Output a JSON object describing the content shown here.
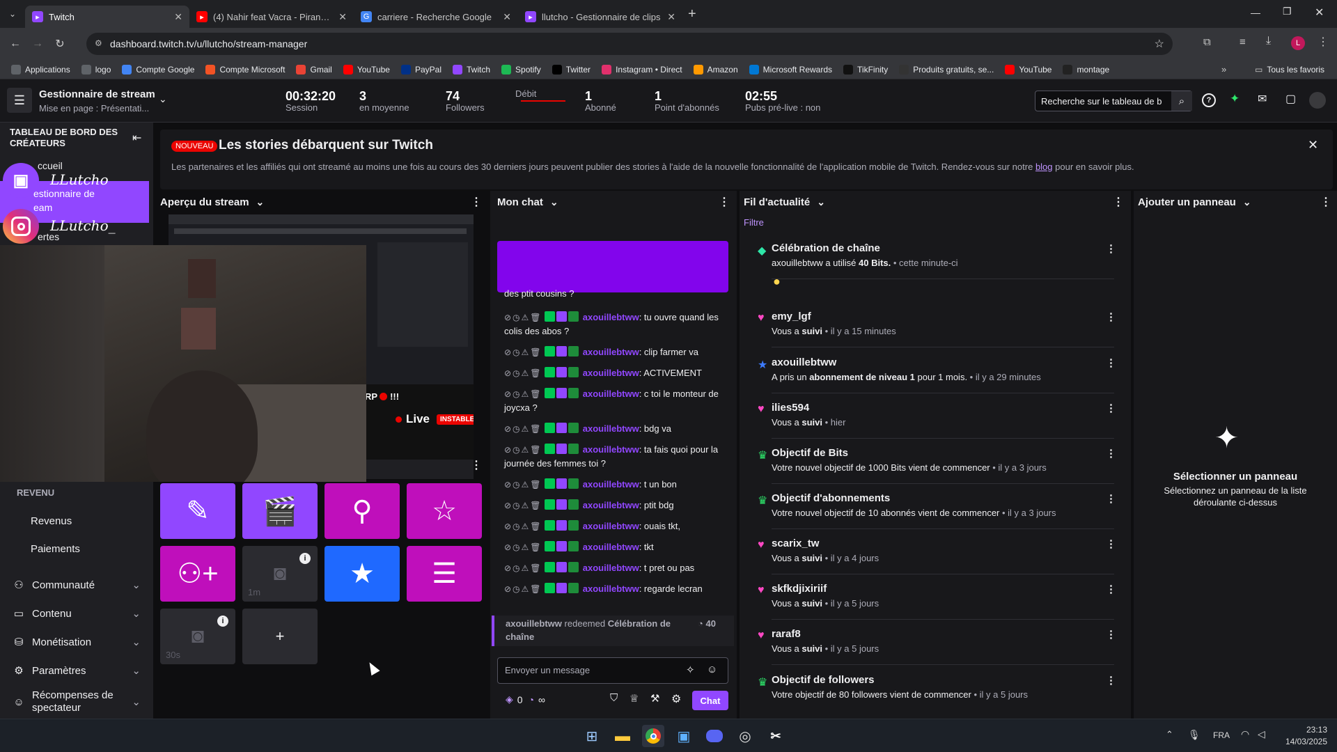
{
  "browser": {
    "tabs": [
      {
        "title": "Twitch",
        "active": true
      },
      {
        "title": "(4) Nahir feat Vacra - Piranha (C",
        "active": false
      },
      {
        "title": "carriere - Recherche Google",
        "active": false
      },
      {
        "title": "llutcho - Gestionnaire de clips",
        "active": false
      }
    ],
    "url": "dashboard.twitch.tv/u/llutcho/stream-manager",
    "bookmarks": [
      "Applications",
      "logo",
      "Compte Google",
      "Compte Microsoft",
      "Gmail",
      "YouTube",
      "PayPal",
      "Twitch",
      "Spotify",
      "Twitter",
      "Instagram • Direct",
      "Amazon",
      "Microsoft Rewards",
      "TikFinity",
      "Produits gratuits, se...",
      "YouTube",
      "montage"
    ],
    "all_bookmarks": "Tous les favoris",
    "profile_letter": "L"
  },
  "header": {
    "title": "Gestionnaire de stream",
    "subtitle": "Mise en page : Présentati...",
    "stats": [
      {
        "value": "00:32:20",
        "label": "Session"
      },
      {
        "value": "3",
        "label": "en moyenne"
      },
      {
        "value": "74",
        "label": "Followers"
      },
      {
        "value": "",
        "label": "Débit"
      },
      {
        "value": "1",
        "label": "Abonné"
      },
      {
        "value": "1",
        "label": "Point d'abonnés"
      },
      {
        "value": "02:55",
        "label": "Pubs pré-live : non"
      }
    ],
    "search_placeholder": "Recherche sur le tableau de b"
  },
  "sidebar": {
    "title": "TABLEAU DE BORD DES CRÉATEURS",
    "items_top": [
      "ccueil",
      "estionnaire de",
      "eam",
      "ertes"
    ],
    "revenue_header": "REVENU",
    "revenue_items": [
      "Revenus",
      "Paiements"
    ],
    "items": [
      {
        "label": "Communauté",
        "icon": "community-icon"
      },
      {
        "label": "Contenu",
        "icon": "content-icon"
      },
      {
        "label": "Monétisation",
        "icon": "monetization-icon"
      },
      {
        "label": "Paramètres",
        "icon": "settings-icon"
      },
      {
        "label": "Récompenses de spectateur",
        "icon": "rewards-icon"
      }
    ]
  },
  "overlay": {
    "twitch_name": "LLutcho",
    "instagram_name": "LLutcho_"
  },
  "banner": {
    "badge": "NOUVEAU",
    "title": "Les stories débarquent sur Twitch",
    "text": "Les partenaires et les affiliés qui ont streamé au moins une fois au cours des 30 derniers jours peuvent publier des stories à l'aide de la nouvelle fonctionnalité de l'application mobile de Twitch. Rendez-vous sur notre",
    "link": "blog",
    "text_end": "pour en savoir plus."
  },
  "preview": {
    "title": "Aperçu du stream",
    "overlay_text": "RP",
    "overlay_bang": "!!!",
    "live": "Live",
    "unstable": "INSTABLE",
    "tiles": [
      {
        "name": "edit-tile",
        "color": "#9147ff",
        "icon": "pencil-icon"
      },
      {
        "name": "clip-tile",
        "color": "#9147ff",
        "icon": "clapper-icon"
      },
      {
        "name": "prediction-tile",
        "color": "#bf0fbb",
        "icon": "prediction-icon"
      },
      {
        "name": "star-tile",
        "color": "#bf0fbb",
        "icon": "star-icon"
      },
      {
        "name": "raid-tile",
        "color": "#bf0fbb",
        "icon": "add-user-icon"
      },
      {
        "name": "ad-1m-tile",
        "color": "#2b2b30",
        "icon": "camera-icon",
        "label": "1m"
      },
      {
        "name": "highlight-tile",
        "color": "#1f69ff",
        "icon": "star-filled-icon"
      },
      {
        "name": "layout-tile",
        "color": "#bf0fbb",
        "icon": "layout-icon"
      },
      {
        "name": "ad-30s-tile",
        "color": "#2b2b30",
        "icon": "camera-icon",
        "label": "30s"
      },
      {
        "name": "add-tile",
        "color": "#2b2b30",
        "icon": "plus-icon",
        "label": "+"
      }
    ]
  },
  "chat": {
    "title": "Mon chat",
    "cut_text": "des ptit cousins ?",
    "messages": [
      {
        "user": "axouillebtww",
        "text": ": tu ouvre quand les colis des abos ?"
      },
      {
        "user": "axouillebtww",
        "text": ": clip farmer va"
      },
      {
        "user": "axouillebtww",
        "text": ": ACTIVEMENT"
      },
      {
        "user": "axouillebtww",
        "text": ": c toi le monteur de joycxa ?"
      },
      {
        "user": "axouillebtww",
        "text": ": bdg va"
      },
      {
        "user": "axouillebtww",
        "text": ": ta fais quoi pour la journée des femmes toi ?"
      },
      {
        "user": "axouillebtww",
        "text": ": t un bon"
      },
      {
        "user": "axouillebtww",
        "text": ": ptit bdg"
      },
      {
        "user": "axouillebtww",
        "text": ": ouais tkt,"
      },
      {
        "user": "axouillebtww",
        "text": ": tkt"
      },
      {
        "user": "axouillebtww",
        "text": ": t pret ou pas"
      },
      {
        "user": "axouillebtww",
        "text": ": regarde lecran"
      }
    ],
    "redeem": {
      "user": "axouillebtww",
      "verb": "redeemed",
      "reward": "Célébration de chaîne",
      "cost": "40"
    },
    "input_placeholder": "Envoyer un message",
    "points": "0",
    "infinity": "∞",
    "chat_button": "Chat"
  },
  "feed": {
    "title": "Fil d'actualité",
    "filter": "Filtre",
    "items": [
      {
        "icon": "bits-icon",
        "color": "#2ee6a8",
        "title": "Célébration de chaîne",
        "pre": "axouillebtww a utilisé ",
        "bold": "40 Bits.",
        "time": " • cette minute-ci"
      },
      {
        "icon": "heart-icon",
        "color": "#ff48c4",
        "title": "emy_lgf",
        "pre": "Vous a ",
        "bold": "suivi",
        "time": " • il y a 15 minutes"
      },
      {
        "icon": "sub-star-icon",
        "color": "#3d7bff",
        "title": "axouillebtww",
        "pre": "A pris un ",
        "bold": "abonnement de niveau 1",
        "post": " pour 1 mois.",
        "time": " • il y a 29 minutes"
      },
      {
        "icon": "heart-icon",
        "color": "#ff48c4",
        "title": "ilies594",
        "pre": "Vous a ",
        "bold": "suivi",
        "time": " • hier"
      },
      {
        "icon": "trophy-icon",
        "color": "#2ee66b",
        "title": "Objectif de Bits",
        "pre": "Votre nouvel objectif de 1000 Bits vient de commencer",
        "time": " • il y a 3 jours"
      },
      {
        "icon": "trophy-icon",
        "color": "#2ee66b",
        "title": "Objectif d'abonnements",
        "pre": "Votre nouvel objectif de 10 abonnés vient de commencer",
        "time": " • il y a 3 jours"
      },
      {
        "icon": "heart-icon",
        "color": "#ff48c4",
        "title": "scarix_tw",
        "pre": "Vous a ",
        "bold": "suivi",
        "time": " • il y a 4 jours"
      },
      {
        "icon": "heart-icon",
        "color": "#ff48c4",
        "title": "skfkdjixiriif",
        "pre": "Vous a ",
        "bold": "suivi",
        "time": " • il y a 5 jours"
      },
      {
        "icon": "heart-icon",
        "color": "#ff48c4",
        "title": "raraf8",
        "pre": "Vous a ",
        "bold": "suivi",
        "time": " • il y a 5 jours"
      },
      {
        "icon": "trophy-icon",
        "color": "#2ee66b",
        "title": "Objectif de followers",
        "pre": "Votre objectif de 80 followers vient de commencer",
        "time": " • il y a 5 jours"
      }
    ]
  },
  "add_panel": {
    "title": "Ajouter un panneau",
    "empty_title": "Sélectionner un panneau",
    "empty_text": "Sélectionnez un panneau de la liste déroulante ci-dessus"
  },
  "taskbar": {
    "lang": "FRA",
    "time": "23:13",
    "date": "14/03/2025"
  },
  "colors": {
    "accent": "#9147ff",
    "magenta": "#bf0fbb",
    "blue": "#1f69ff",
    "bg": "#0e0e10"
  }
}
